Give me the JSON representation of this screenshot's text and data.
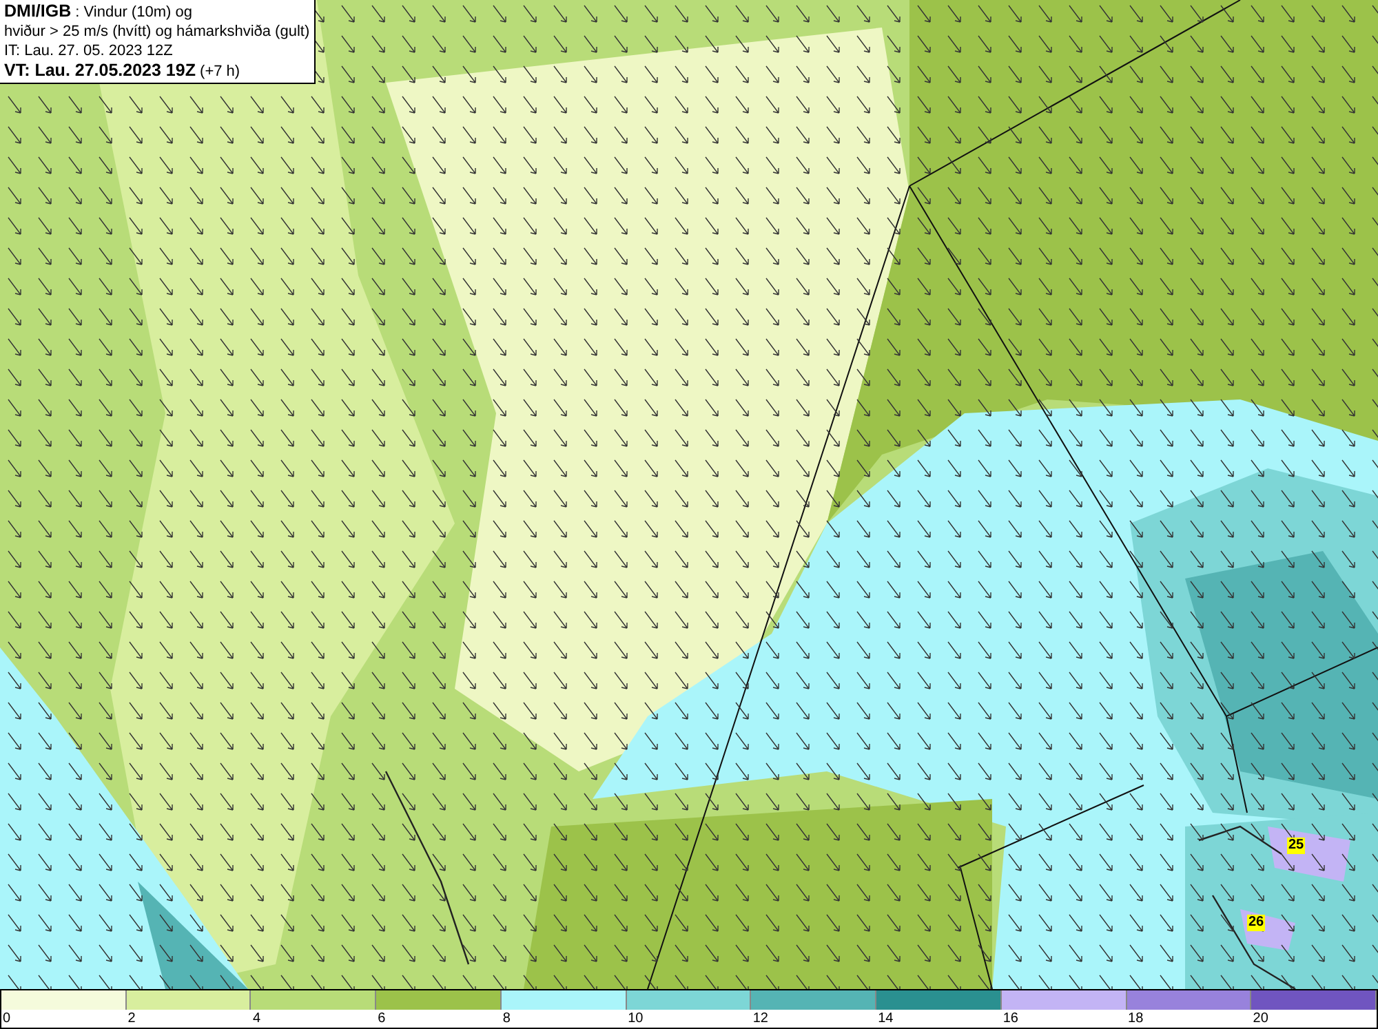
{
  "title_box": {
    "source": "DMI/IGB",
    "lines": [
      ": Vindur (10m) og",
      "hviður > 25 m/s (hvítt) og hámarkshviða (gult)",
      "IT: Lau. 27. 05. 2023 12Z"
    ],
    "valid_time": "VT: Lau. 27.05.2023 19Z",
    "lead": "(+7 h)"
  },
  "gust_labels": [
    "25",
    "26"
  ],
  "legend": {
    "bins": [
      {
        "color": "#f5fbdc"
      },
      {
        "color": "#d8ee9e"
      },
      {
        "color": "#b8dc78"
      },
      {
        "color": "#9cc24a"
      },
      {
        "color": "#aaf5fa"
      },
      {
        "color": "#7dd6d6"
      },
      {
        "color": "#55b4b4"
      },
      {
        "color": "#2a9090"
      },
      {
        "color": "#c3b4f5"
      },
      {
        "color": "#9882dc"
      },
      {
        "color": "#7055c0"
      }
    ],
    "ticks": [
      "0",
      "2",
      "4",
      "6",
      "8",
      "10",
      "12",
      "14",
      "16",
      "18",
      "20"
    ]
  }
}
